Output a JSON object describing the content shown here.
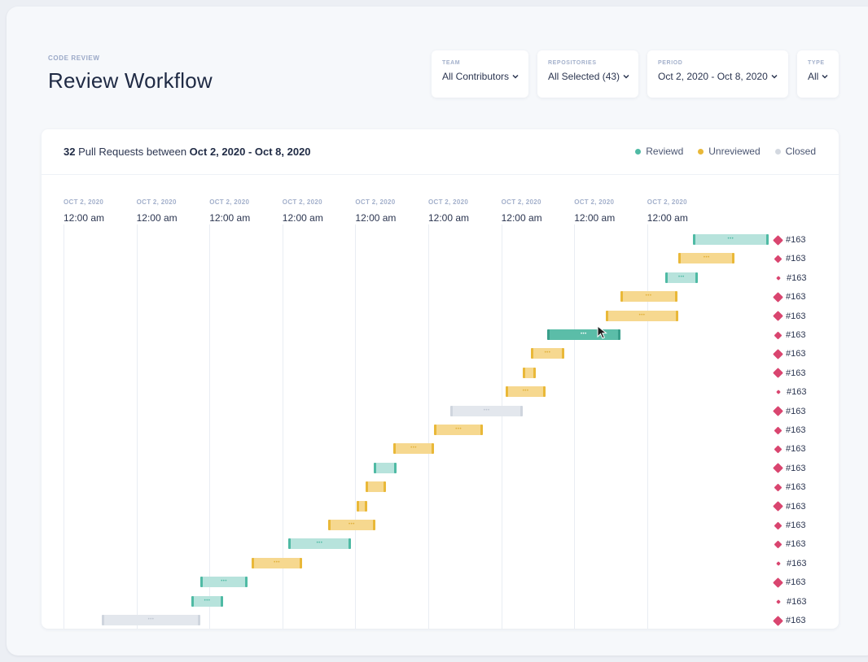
{
  "header": {
    "eyebrow": "CODE REVIEW",
    "title": "Review Workflow"
  },
  "filters": [
    {
      "label": "TEAM",
      "value": "All Contributors"
    },
    {
      "label": "REPOSITORIES",
      "value": "All Selected (43)"
    },
    {
      "label": "PERIOD",
      "value": "Oct 2, 2020 - Oct 8, 2020"
    },
    {
      "label": "TYPE",
      "value": "All"
    }
  ],
  "summary": {
    "count": "32",
    "text": " Pull Requests between ",
    "range": "Oct 2, 2020 - Oct 8, 2020"
  },
  "legend": [
    {
      "label": "Reviewd",
      "color": "#4fbaa4"
    },
    {
      "label": "Unreviewed",
      "color": "#e9b838"
    },
    {
      "label": "Closed",
      "color": "#d3d8e0"
    }
  ],
  "axis": [
    {
      "date": "OCT 2, 2020",
      "time": "12:00 am"
    },
    {
      "date": "OCT 2, 2020",
      "time": "12:00 am"
    },
    {
      "date": "OCT 2, 2020",
      "time": "12:00 am"
    },
    {
      "date": "OCT 2, 2020",
      "time": "12:00 am"
    },
    {
      "date": "OCT 2, 2020",
      "time": "12:00 am"
    },
    {
      "date": "OCT 2, 2020",
      "time": "12:00 am"
    },
    {
      "date": "OCT 2, 2020",
      "time": "12:00 am"
    },
    {
      "date": "OCT 2, 2020",
      "time": "12:00 am"
    },
    {
      "date": "OCT 2, 2020",
      "time": "12:00 am"
    }
  ],
  "bar_glyph": "•••",
  "pull_requests": [
    {
      "id": "#163",
      "status": "reviewed",
      "start": 8.63,
      "end": 9.66,
      "marker": "large"
    },
    {
      "id": "#163",
      "status": "unreviewed",
      "start": 8.43,
      "end": 9.2,
      "marker": "medium"
    },
    {
      "id": "#163",
      "status": "reviewed",
      "start": 8.25,
      "end": 8.69,
      "marker": "small"
    },
    {
      "id": "#163",
      "status": "unreviewed",
      "start": 7.63,
      "end": 8.41,
      "marker": "large"
    },
    {
      "id": "#163",
      "status": "unreviewed",
      "start": 7.43,
      "end": 8.43,
      "marker": "large"
    },
    {
      "id": "#163",
      "status": "reviewed",
      "start": 6.63,
      "end": 7.63,
      "marker": "medium",
      "active": true
    },
    {
      "id": "#163",
      "status": "unreviewed",
      "start": 6.41,
      "end": 6.86,
      "marker": "large"
    },
    {
      "id": "#163",
      "status": "unreviewed",
      "start": 6.3,
      "end": 6.47,
      "marker": "large"
    },
    {
      "id": "#163",
      "status": "unreviewed",
      "start": 6.06,
      "end": 6.61,
      "marker": "small"
    },
    {
      "id": "#163",
      "status": "closed",
      "start": 5.3,
      "end": 6.3,
      "marker": "large"
    },
    {
      "id": "#163",
      "status": "unreviewed",
      "start": 5.08,
      "end": 5.75,
      "marker": "medium"
    },
    {
      "id": "#163",
      "status": "unreviewed",
      "start": 4.52,
      "end": 5.08,
      "marker": "medium"
    },
    {
      "id": "#163",
      "status": "reviewed",
      "start": 4.25,
      "end": 4.56,
      "marker": "large"
    },
    {
      "id": "#163",
      "status": "unreviewed",
      "start": 4.14,
      "end": 4.42,
      "marker": "medium"
    },
    {
      "id": "#163",
      "status": "unreviewed",
      "start": 4.02,
      "end": 4.16,
      "marker": "large"
    },
    {
      "id": "#163",
      "status": "unreviewed",
      "start": 3.63,
      "end": 4.27,
      "marker": "medium"
    },
    {
      "id": "#163",
      "status": "reviewed",
      "start": 3.08,
      "end": 3.94,
      "marker": "medium"
    },
    {
      "id": "#163",
      "status": "unreviewed",
      "start": 2.58,
      "end": 3.27,
      "marker": "small"
    },
    {
      "id": "#163",
      "status": "reviewed",
      "start": 1.88,
      "end": 2.52,
      "marker": "large"
    },
    {
      "id": "#163",
      "status": "reviewed",
      "start": 1.75,
      "end": 2.19,
      "marker": "small"
    },
    {
      "id": "#163",
      "status": "closed",
      "start": 0.52,
      "end": 1.88,
      "marker": "large"
    }
  ]
}
